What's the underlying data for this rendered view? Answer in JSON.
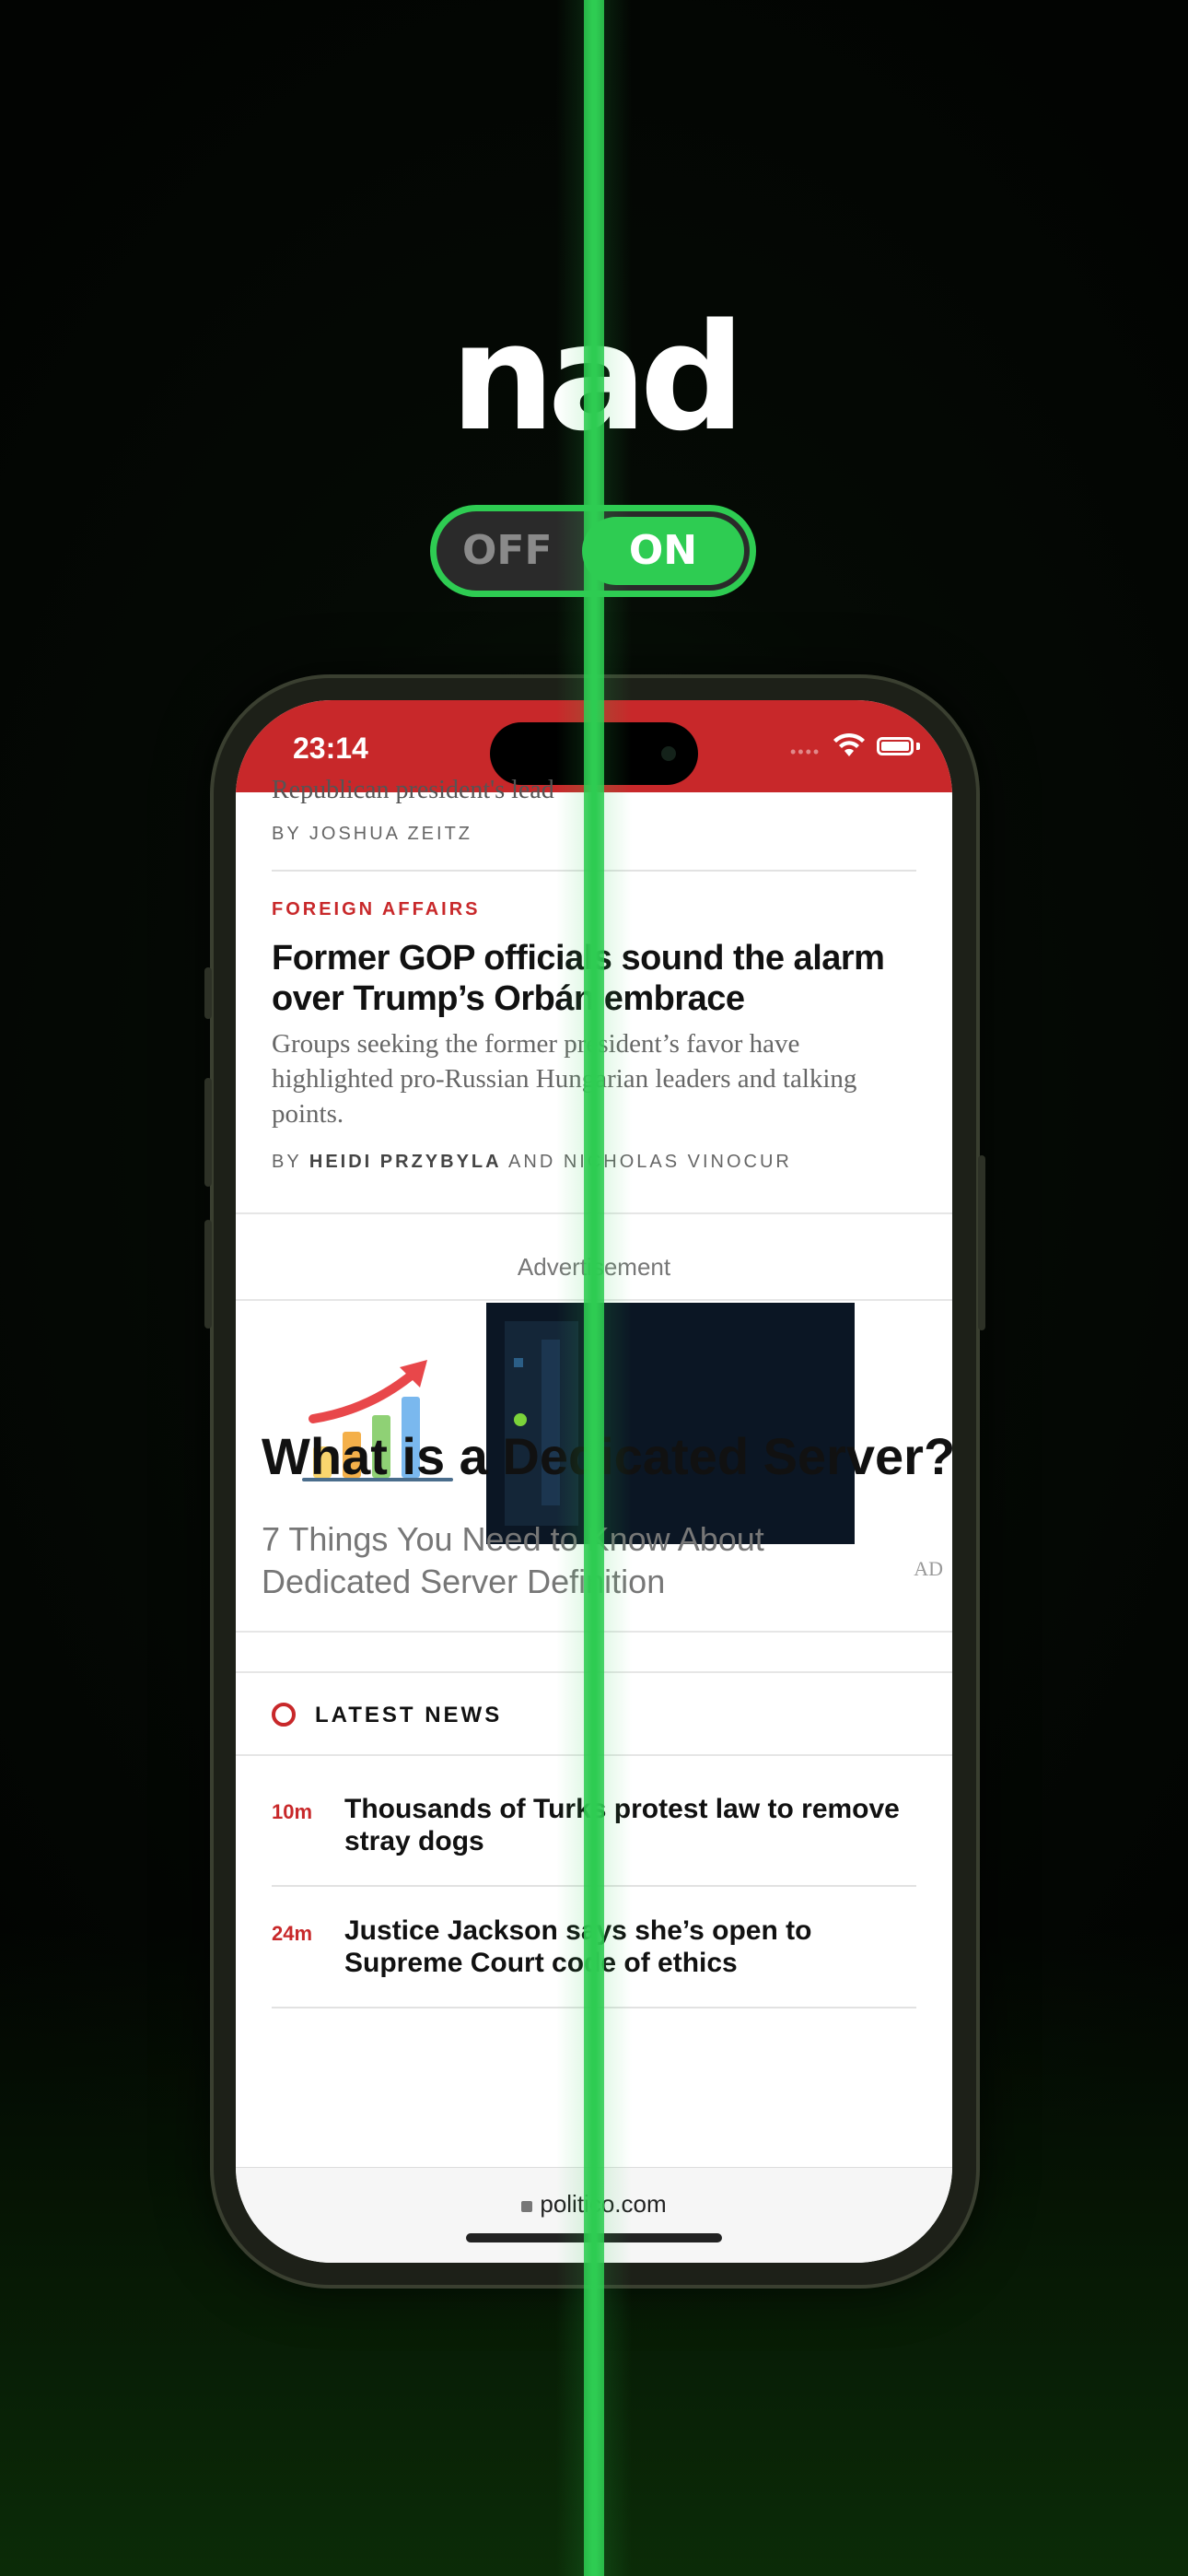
{
  "branding": {
    "logo_text": "nad"
  },
  "toggle": {
    "off_label": "OFF",
    "on_label": "ON"
  },
  "status_bar": {
    "time": "23:14"
  },
  "article_top": {
    "cut_text": "Republican president's lead",
    "byline_prefix": "BY",
    "byline_name": "JOSHUA ZEITZ"
  },
  "article": {
    "kicker": "FOREIGN AFFAIRS",
    "headline": "Former GOP officials sound the alarm over Trump’s Orbán embrace",
    "dek": "Groups seeking the former president’s favor have highlighted pro-Russian Hungarian leaders and talking points.",
    "byline_prefix": "BY",
    "author1": "HEIDI PRZYBYLA",
    "byline_and": "AND",
    "author2": "NICHOLAS VINOCUR"
  },
  "ad": {
    "label": "Advertisement",
    "title": "What is a Dedicated Server?",
    "subtitle_line1": "7 Things You Need to Know About",
    "subtitle_line2": "Dedicated Server Definition",
    "tag": "AD"
  },
  "latest": {
    "title": "LATEST NEWS",
    "items": [
      {
        "time": "10m",
        "title": "Thousands of Turks protest law to remove stray dogs"
      },
      {
        "time": "24m",
        "title": "Justice Jackson says she’s open to Supreme Court code of ethics"
      }
    ]
  },
  "browser": {
    "url": "politico.com"
  },
  "colors": {
    "accent_green": "#2ecc52",
    "politico_red": "#c8282a"
  }
}
